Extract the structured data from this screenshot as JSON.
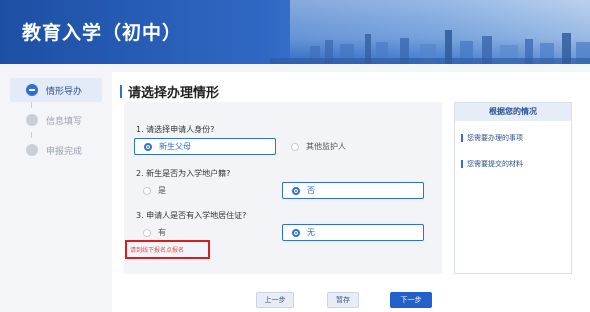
{
  "header": {
    "title": "教育入学（初中）"
  },
  "steps": [
    {
      "label": "情形导办",
      "active": true
    },
    {
      "label": "信息填写",
      "active": false
    },
    {
      "label": "申报完成",
      "active": false
    }
  ],
  "main": {
    "section_title": "请选择办理情形",
    "questions": [
      {
        "text": "1. 请选择申请人身份?",
        "options": [
          "新生父母",
          "其他监护人"
        ],
        "selected": "新生父母"
      },
      {
        "text": "2. 新生是否为入学地户籍?",
        "options": [
          "是",
          "否"
        ],
        "selected": "否"
      },
      {
        "text": "3. 申请人是否有入学地居住证?",
        "options": [
          "有",
          "无"
        ],
        "selected": "无"
      }
    ],
    "notice": "请到线下报名点报名"
  },
  "side_panel": {
    "title": "根据您的情况",
    "items": [
      "您需要办理的事项",
      "您需要提交的材料"
    ]
  },
  "footer": {
    "prev_label": "上一步",
    "save_label": "暂存",
    "next_label": "下一步"
  },
  "colors": {
    "accent": "#2f6fd6",
    "primary_button": "#2261c9",
    "warning_text": "#d9534f",
    "highlight_border": "#d81e1e"
  }
}
